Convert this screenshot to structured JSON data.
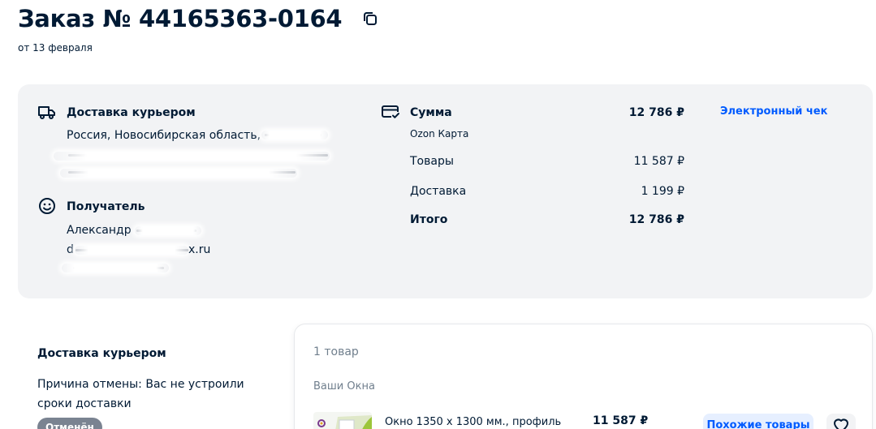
{
  "order": {
    "title": "Заказ № 44165363-0164",
    "date": "от 13 февраля"
  },
  "delivery": {
    "title": "Доставка курьером",
    "address_line1": "Россия, Новосибирская область,"
  },
  "recipient": {
    "title": "Получатель",
    "name": "Александр",
    "email_prefix": "d",
    "email_suffix": "x.ru"
  },
  "payment": {
    "title": "Сумма",
    "total_top": "12 786 ₽",
    "method": "Ozon Карта",
    "receipt_link": "Электронный чек",
    "rows": [
      {
        "label": "Товары",
        "amount": "11 587 ₽"
      },
      {
        "label": "Доставка",
        "amount": "1 199 ₽"
      },
      {
        "label": "Итого",
        "amount": "12 786 ₽"
      }
    ]
  },
  "shipment": {
    "title": "Доставка курьером",
    "reason": "Причина отмены: Вас не устроили сроки доставки",
    "status": "Отменён"
  },
  "goods": {
    "count": "1 товар",
    "seller": "Ваши Окна",
    "item": {
      "name": "Окно 1350 х 1300 мм., профиль",
      "price": "11 587 ₽"
    },
    "similar_button": "Похожие товары"
  },
  "colors": {
    "text": "#001a34",
    "accent": "#005bff",
    "card_bg": "#f2f3f5",
    "muted": "#707f8d"
  }
}
